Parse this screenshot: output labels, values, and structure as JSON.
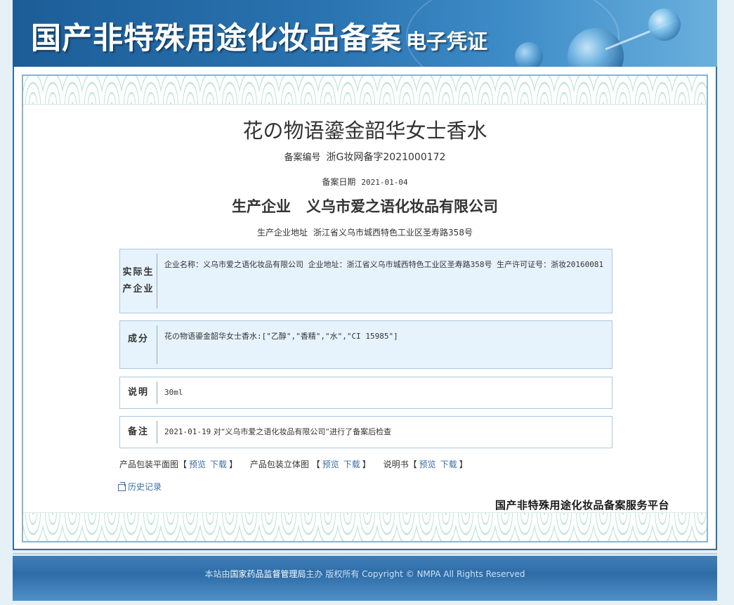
{
  "banner": {
    "title": "国产非特殊用途化妆品备案",
    "subtitle": "电子凭证"
  },
  "certificate": {
    "product_name": "花の物语鎏金韶华女士香水",
    "reg_no_label": "备案编号",
    "reg_no": "浙G妆网备字2021000172",
    "date_label": "备案日期",
    "date": "2021-01-04",
    "producer_label": "生产企业",
    "producer": "义乌市爱之语化妆品有限公司",
    "producer_addr_label": "生产企业地址",
    "producer_addr": "浙江省义乌市城西特色工业区圣寿路358号"
  },
  "sections": {
    "actual_producer": {
      "label": "实际生产企业",
      "text": "企业名称：义乌市爱之语化妆品有限公司   企业地址：浙江省义乌市城西特色工业区圣寿路358号   生产许可证号：浙妆20160081"
    },
    "ingredients": {
      "label": "成分",
      "text": "花の物语鎏金韶华女士香水:[\"乙醇\",\"香精\",\"水\",\"CI 15985\"]"
    },
    "description": {
      "label": "说明",
      "text": "30ml"
    },
    "remarks": {
      "label": "备注",
      "date": "2021-01-19",
      "text": "对“义乌市爱之语化妆品有限公司”进行了备案后检查"
    }
  },
  "links": {
    "flat_label": "产品包装平面图",
    "solid_label": "产品包装立体图",
    "manual_label": "说明书",
    "preview": "预览",
    "download": "下载",
    "bracket_open": "【",
    "bracket_close": "】"
  },
  "history_label": "历史记录",
  "platform_name": "国产非特殊用途化妆品备案服务平台",
  "footer": {
    "prefix": "本站由",
    "org": "国家药品监督管理局",
    "suffix": "主办 版权所有 Copyright © NMPA All Rights Reserved"
  }
}
